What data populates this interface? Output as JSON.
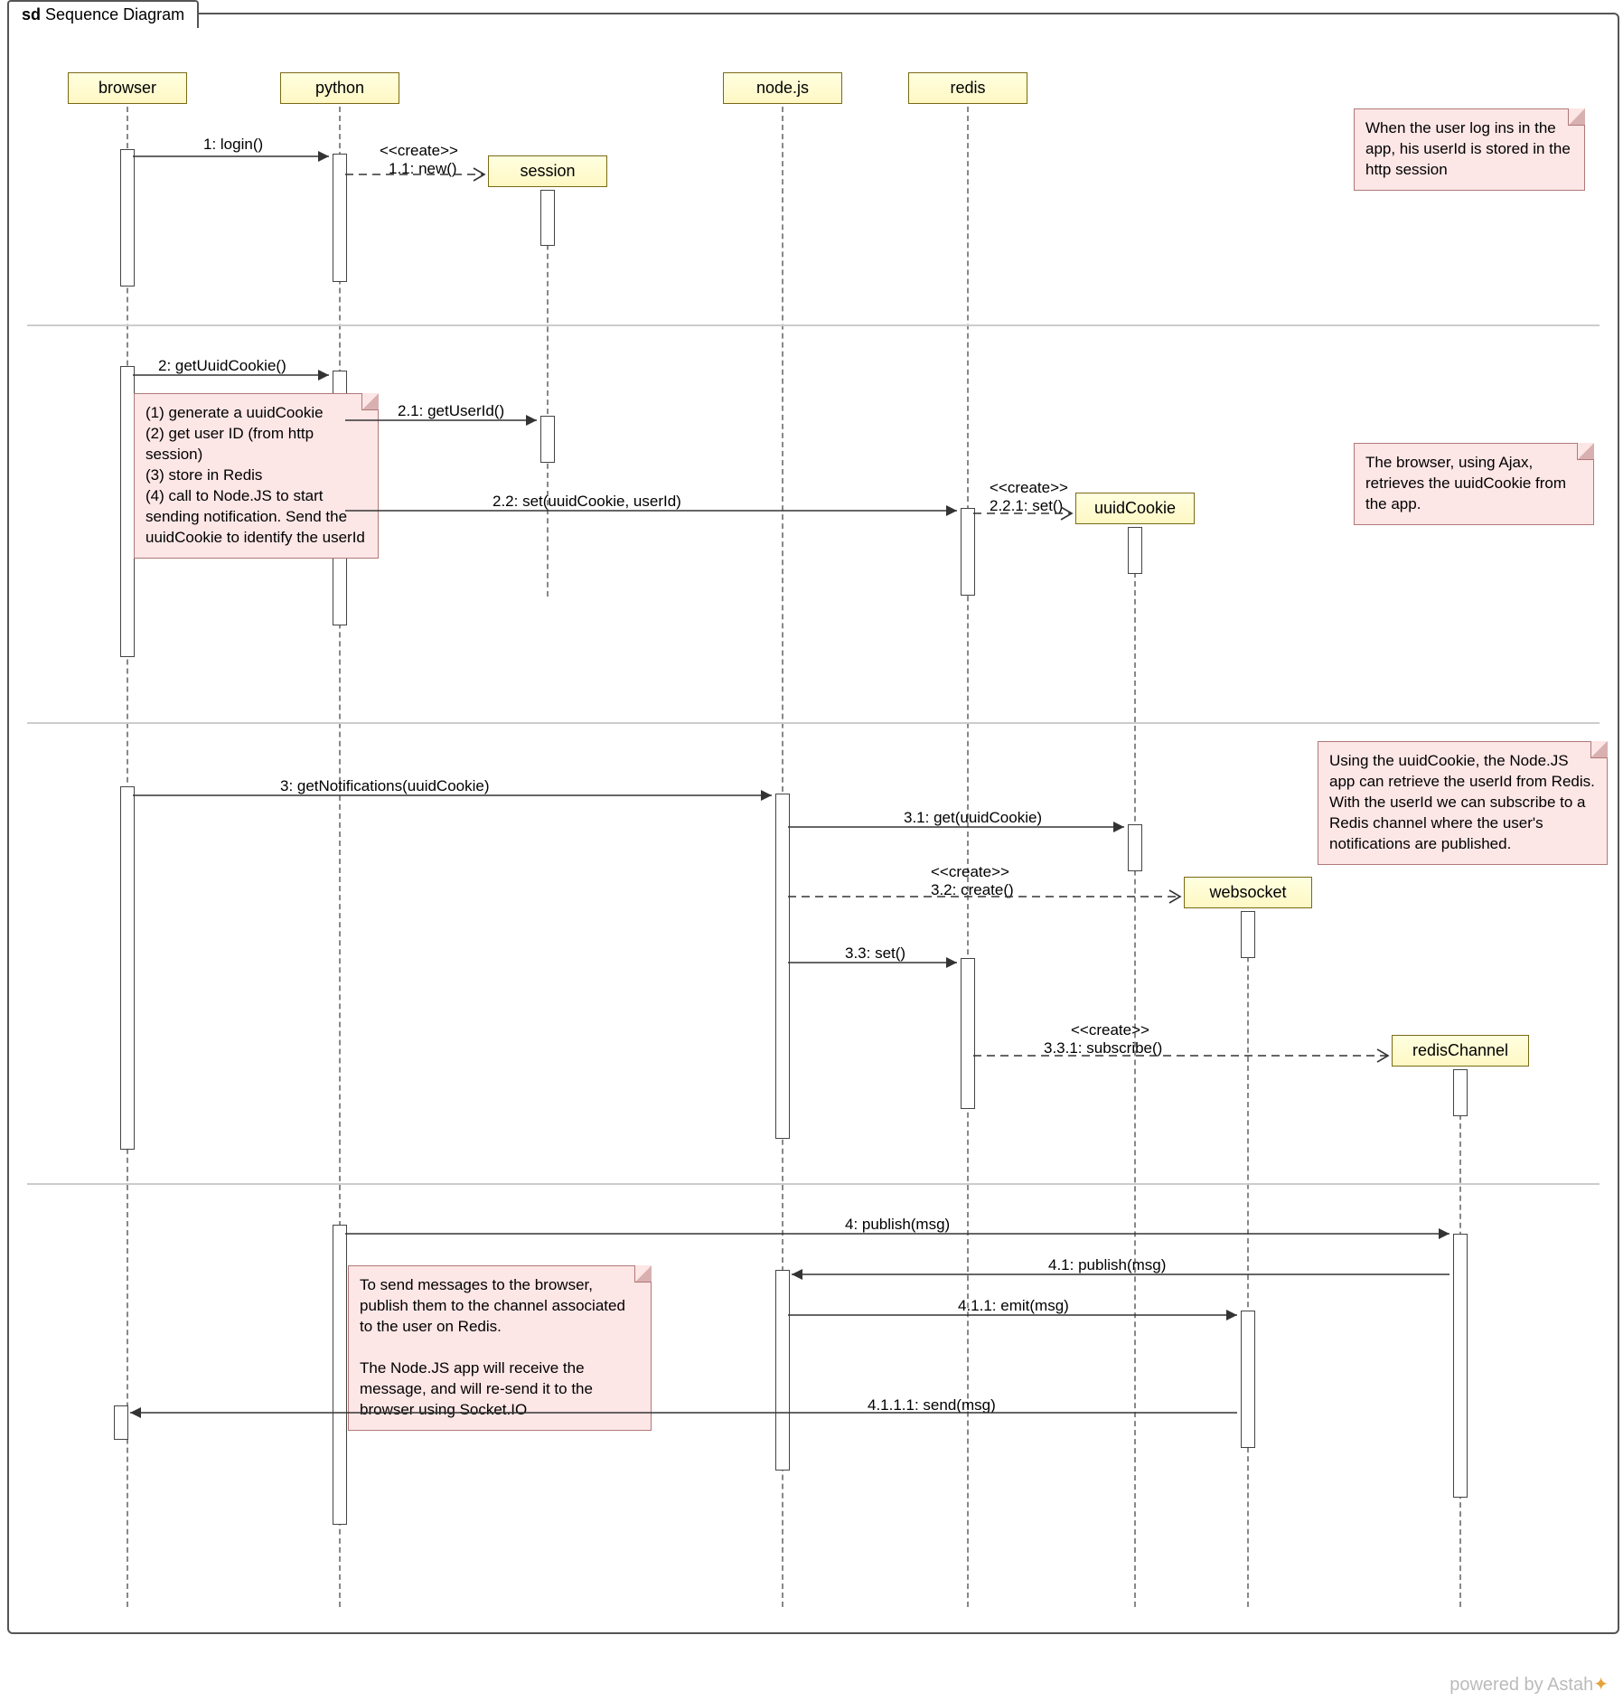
{
  "frame_title_prefix": "sd",
  "frame_title": "Sequence Diagram",
  "lifelines": {
    "browser": "browser",
    "python": "python",
    "nodejs": "node.js",
    "redis": "redis",
    "session": "session",
    "uuidCookie": "uuidCookie",
    "websocket": "websocket",
    "redisChannel": "redisChannel"
  },
  "messages": {
    "m1": "1: login()",
    "m1_create": "<<create>>",
    "m1_1": "1.1: new()",
    "m2": "2: getUuidCookie()",
    "m2_1": "2.1: getUserId()",
    "m2_2": "2.2: set(uuidCookie, userId)",
    "m2_2_create": "<<create>>",
    "m2_2_1": "2.2.1: set()",
    "m3": "3: getNotifications(uuidCookie)",
    "m3_1": "3.1: get(uuidCookie)",
    "m3_2_create": "<<create>>",
    "m3_2": "3.2: create()",
    "m3_3": "3.3: set()",
    "m3_3_create": "<<create>>",
    "m3_3_1": "3.3.1: subscribe()",
    "m4": "4: publish(msg)",
    "m4_1": "4.1: publish(msg)",
    "m4_1_1": "4.1.1: emit(msg)",
    "m4_1_1_1": "4.1.1.1: send(msg)"
  },
  "notes": {
    "n1": "When the user log ins in the app, his userId is stored in the http session",
    "n2a": "(1) generate a uuidCookie",
    "n2b": "(2) get user ID (from http session)",
    "n2c": "(3) store in Redis",
    "n2d": "(4) call to Node.JS to start sending notification. Send the uuidCookie to identify the userId",
    "n3": "The browser, using Ajax, retrieves the uuidCookie from the app.",
    "n4": "Using the uuidCookie, the Node.JS app can retrieve the userId from Redis. With the userId we can subscribe to a Redis channel where the user's notifications are published.",
    "n5a": "To send messages to the  browser, publish them to the channel associated to the user on Redis.",
    "n5b": "The Node.JS app will receive the message, and will re-send it to the browser using Socket.IO"
  },
  "footer": "powered by Astah"
}
